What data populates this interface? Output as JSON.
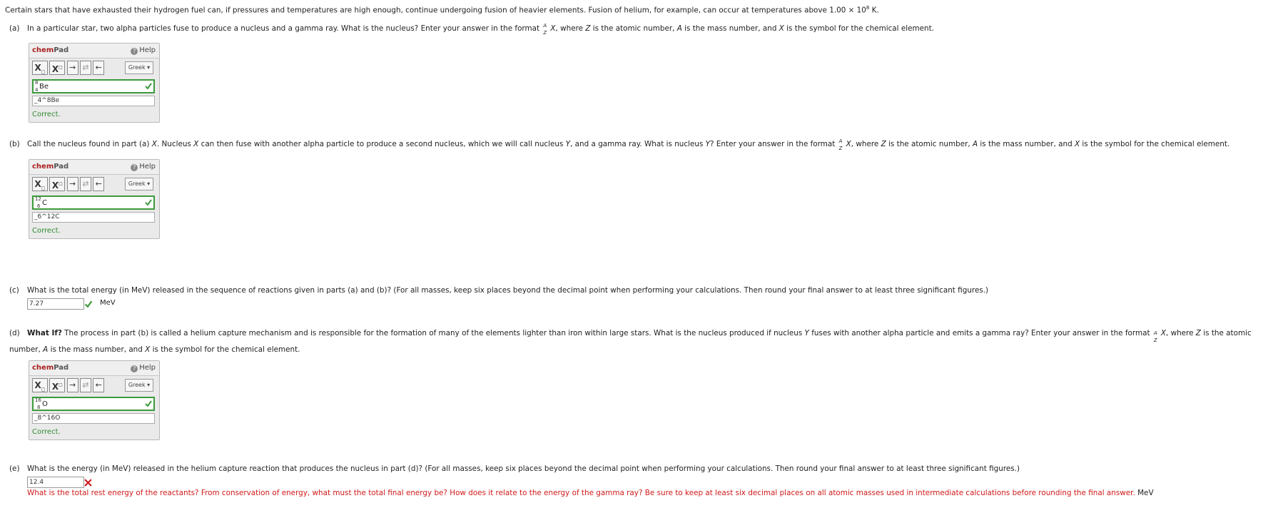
{
  "intro": {
    "text": "Certain stars that have exhausted their hydrogen fuel can, if pressures and temperatures are high enough, continue undergoing fusion of heavier elements. Fusion of helium, for example, can occur at temperatures above 1.00 × 10",
    "exp": "8",
    "tail": " K."
  },
  "format_text": {
    "prefix": "Enter your answer in the format ",
    "a_label": "A",
    "z_label": "Z",
    "x_label": "X",
    "suffix_1": ", where ",
    "z": "Z",
    "suffix_2": " is the atomic number, ",
    "a": "A",
    "suffix_3": " is the mass number, and ",
    "x": "X",
    "suffix_4": " is the symbol for the chemical element."
  },
  "part_a": {
    "label": "(a)",
    "text": "In a particular star, two alpha particles fuse to produce a nucleus and a gamma ray. What is the nucleus? ",
    "answer": {
      "mass": "8",
      "atomic": "4",
      "symbol": "Be"
    },
    "raw": "_4^8Be",
    "status": "Correct."
  },
  "part_b": {
    "label": "(b)",
    "text_1": "Call the nucleus found in part (a) ",
    "x": "X",
    "text_2": ". Nucleus ",
    "text_3": " can then fuse with another alpha particle to produce a second nucleus, which we will call nucleus ",
    "y": "Y",
    "text_4": ", and a gamma ray. What is nucleus ",
    "text_5": "? ",
    "answer": {
      "mass": "12",
      "atomic": "6",
      "symbol": "C"
    },
    "raw": "_6^12C",
    "status": "Correct."
  },
  "part_c": {
    "label": "(c)",
    "text": "What is the total energy (in MeV) released in the sequence of reactions given in parts (a) and (b)? (For all masses, keep six places beyond the decimal point when performing your calculations. Then round your final answer to at least three significant figures.)",
    "value": "7.27",
    "unit": "MeV"
  },
  "part_d": {
    "label": "(d)",
    "bold": "What If?",
    "text_1": " The process in part (b) is called a helium capture mechanism and is responsible for the formation of many of the elements lighter than iron within large stars. What is the nucleus produced if nucleus ",
    "y": "Y",
    "text_2": " fuses with another alpha particle and emits a gamma ray? ",
    "answer": {
      "mass": "16",
      "atomic": "8",
      "symbol": "O"
    },
    "raw": "_8^16O",
    "status": "Correct."
  },
  "part_e": {
    "label": "(e)",
    "text": "What is the energy (in MeV) released in the helium capture reaction that produces the nucleus in part (d)? (For all masses, keep six places beyond the decimal point when performing your calculations. Then round your final answer to at least three significant figures.)",
    "value": "12.4",
    "hint": "What is the total rest energy of the reactants? From conservation of energy, what must the total final energy be? How does it relate to the energy of the gamma ray? Be sure to keep at least six decimal places on all atomic masses used in intermediate calculations before rounding the final answer.",
    "unit": "MeV"
  },
  "chempad": {
    "title_1": "chem",
    "title_2": "Pad",
    "help": "Help",
    "greek": "Greek ▾",
    "sub_btn": "X",
    "sup_btn": "X",
    "arrow_right": "→",
    "arrow_equil": "⇄",
    "arrow_left": "←"
  },
  "colors": {
    "correct": "#3c9a3c",
    "incorrect": "#d21a1a",
    "brand": "#a81e1e"
  }
}
